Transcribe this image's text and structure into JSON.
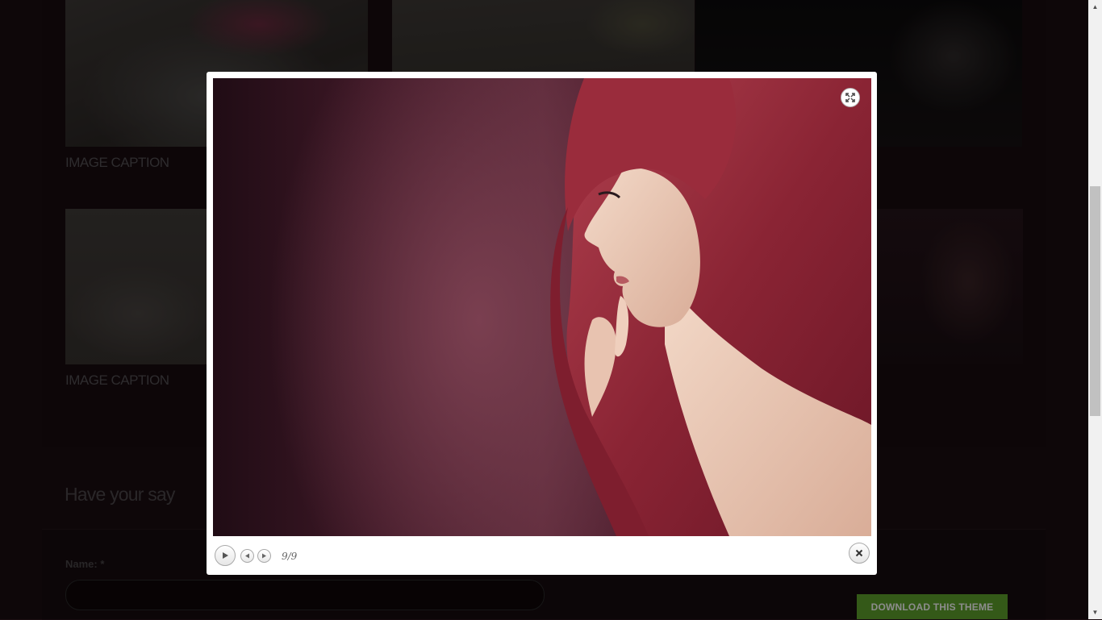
{
  "gallery": {
    "captions": [
      "IMAGE CAPTION",
      "IMAGE CAPTION"
    ]
  },
  "comments": {
    "heading": "Have your say",
    "name_label": "Name: *",
    "name_value": ""
  },
  "download_button": "DOWNLOAD THIS THEME",
  "lightbox": {
    "counter": "9/9",
    "icons": {
      "expand": "expand-icon",
      "play": "play-icon",
      "prev": "prev-icon",
      "next": "next-icon",
      "close": "close-icon"
    }
  },
  "colors": {
    "accent": "#5fa32d",
    "background": "#1b0e12"
  }
}
